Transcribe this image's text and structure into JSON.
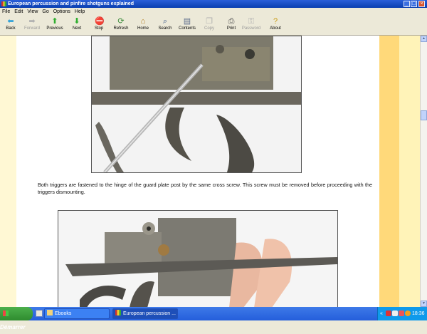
{
  "window": {
    "title": "European percussion and pinfire shotguns explained"
  },
  "menu": [
    "File",
    "Edit",
    "View",
    "Go",
    "Options",
    "Help"
  ],
  "toolbar": {
    "back": "Back",
    "forward": "Forward",
    "previous": "Previous",
    "next": "Next",
    "stop": "Stop",
    "refresh": "Refresh",
    "home": "Home",
    "search": "Search",
    "contents": "Contents",
    "copy": "Copy",
    "print": "Print",
    "password": "Password",
    "about": "About"
  },
  "content": {
    "caption": "Both triggers are fastened to the hinge of the guard plate post by the same cross screw. This screw must be removed before proceeding with the triggers dismounting."
  },
  "taskbar": {
    "start": "Démarrer",
    "tasks": [
      "Ebooks",
      "European percussion ..."
    ],
    "clock": "18:36",
    "tray_collapse": "«"
  },
  "icons": {
    "back": "arrow-left-icon",
    "forward": "arrow-right-icon",
    "previous": "arrow-up-icon",
    "next": "arrow-down-icon",
    "stop": "stop-icon",
    "refresh": "refresh-icon",
    "home": "home-icon",
    "search": "search-icon",
    "contents": "contents-icon",
    "copy": "copy-icon",
    "print": "print-icon",
    "password": "key-icon",
    "about": "help-icon"
  },
  "colors": {
    "titlebar": "#0a3fb0",
    "page_bg": "#ffffff",
    "stripe": "#ffd97a",
    "taskbar": "#245edb"
  }
}
